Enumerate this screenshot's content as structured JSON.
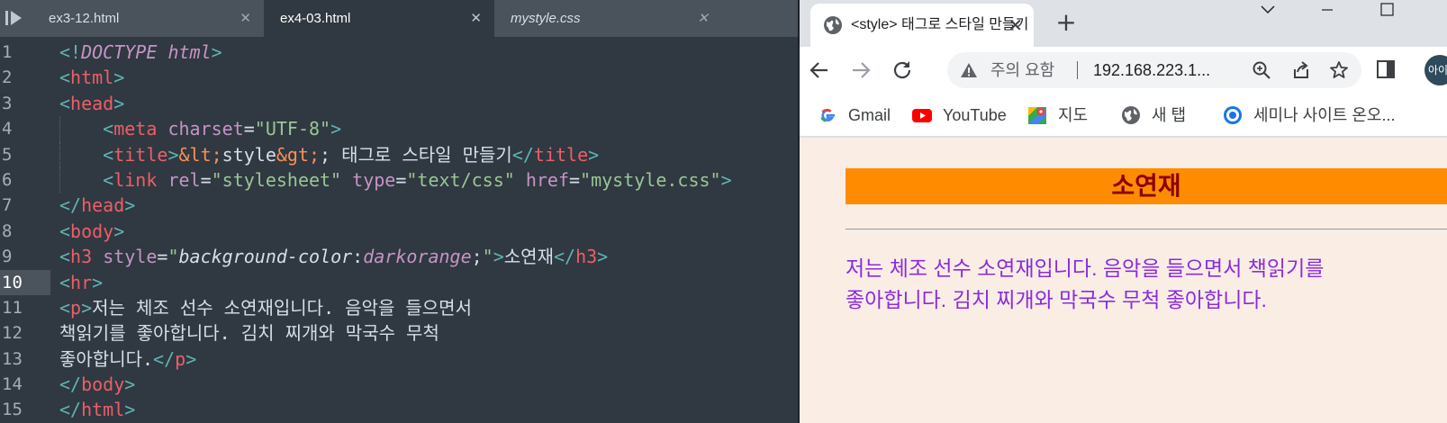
{
  "editor": {
    "tabs": [
      {
        "label": "ex3-12.html",
        "close": "✕"
      },
      {
        "label": "ex4-03.html",
        "close": "✕"
      },
      {
        "label": "mystyle.css",
        "close": "✕"
      }
    ],
    "current_line": 10,
    "lines": [
      {
        "num": "1",
        "tokens": [
          [
            "p",
            "<!"
          ],
          [
            "kw",
            "DOCTYPE"
          ],
          [
            "w",
            " "
          ],
          [
            "kw",
            "html"
          ],
          [
            "p",
            ">"
          ]
        ]
      },
      {
        "num": "2",
        "tokens": [
          [
            "p",
            "<"
          ],
          [
            "t",
            "html"
          ],
          [
            "p",
            ">"
          ]
        ]
      },
      {
        "num": "3",
        "tokens": [
          [
            "p",
            "<"
          ],
          [
            "t",
            "head"
          ],
          [
            "p",
            ">"
          ]
        ]
      },
      {
        "num": "4",
        "indent": "    ",
        "tokens": [
          [
            "p",
            "<"
          ],
          [
            "t",
            "meta"
          ],
          [
            "w",
            " "
          ],
          [
            "a",
            "charset"
          ],
          [
            "w",
            "="
          ],
          [
            "s",
            "\"UTF-8\""
          ],
          [
            "p",
            ">"
          ]
        ]
      },
      {
        "num": "5",
        "indent": "    ",
        "tokens": [
          [
            "p",
            "<"
          ],
          [
            "t",
            "title"
          ],
          [
            "p",
            ">"
          ],
          [
            "e",
            "&lt;"
          ],
          [
            "w",
            "style"
          ],
          [
            "e",
            "&gt;"
          ],
          [
            "w",
            "; 태그로 스타일 만들기"
          ],
          [
            "p",
            "</"
          ],
          [
            "t",
            "title"
          ],
          [
            "p",
            ">"
          ]
        ]
      },
      {
        "num": "6",
        "indent": "    ",
        "tokens": [
          [
            "p",
            "<"
          ],
          [
            "t",
            "link"
          ],
          [
            "w",
            " "
          ],
          [
            "a",
            "rel"
          ],
          [
            "w",
            "="
          ],
          [
            "s",
            "\"stylesheet\""
          ],
          [
            "w",
            " "
          ],
          [
            "a",
            "type"
          ],
          [
            "w",
            "="
          ],
          [
            "s",
            "\"text/css\""
          ],
          [
            "w",
            " "
          ],
          [
            "a",
            "href"
          ],
          [
            "w",
            "="
          ],
          [
            "s",
            "\"mystyle.css\""
          ],
          [
            "p",
            ">"
          ]
        ]
      },
      {
        "num": "7",
        "tokens": [
          [
            "p",
            "</"
          ],
          [
            "t",
            "head"
          ],
          [
            "p",
            ">"
          ]
        ]
      },
      {
        "num": "8",
        "tokens": [
          [
            "p",
            "<"
          ],
          [
            "t",
            "body"
          ],
          [
            "p",
            ">"
          ]
        ]
      },
      {
        "num": "9",
        "tokens": [
          [
            "p",
            "<"
          ],
          [
            "t",
            "h3"
          ],
          [
            "w",
            " "
          ],
          [
            "a",
            "style"
          ],
          [
            "w",
            "="
          ],
          [
            "s",
            "\""
          ],
          [
            "wi",
            "background-color"
          ],
          [
            "w",
            ":"
          ],
          [
            "ai",
            "darkorange"
          ],
          [
            "w",
            ";"
          ],
          [
            "s",
            "\""
          ],
          [
            "p",
            ">"
          ],
          [
            "w",
            "소연재"
          ],
          [
            "p",
            "</"
          ],
          [
            "t",
            "h3"
          ],
          [
            "p",
            ">"
          ]
        ]
      },
      {
        "num": "10",
        "tokens": [
          [
            "p",
            "<"
          ],
          [
            "t",
            "hr"
          ],
          [
            "p",
            ">"
          ]
        ]
      },
      {
        "num": "11",
        "tokens": [
          [
            "p",
            "<"
          ],
          [
            "t",
            "p"
          ],
          [
            "p",
            ">"
          ],
          [
            "w",
            "저는 체조 선수 소연재입니다. 음악을 들으면서"
          ]
        ]
      },
      {
        "num": "12",
        "tokens": [
          [
            "w",
            "책읽기를 좋아합니다. 김치 찌개와 막국수 무척"
          ]
        ]
      },
      {
        "num": "13",
        "tokens": [
          [
            "w",
            "좋아합니다."
          ],
          [
            "p",
            "</"
          ],
          [
            "t",
            "p"
          ],
          [
            "p",
            ">"
          ]
        ]
      },
      {
        "num": "14",
        "tokens": [
          [
            "p",
            "</"
          ],
          [
            "t",
            "body"
          ],
          [
            "p",
            ">"
          ]
        ]
      },
      {
        "num": "15",
        "tokens": [
          [
            "p",
            "</"
          ],
          [
            "t",
            "html"
          ],
          [
            "p",
            ">"
          ]
        ]
      }
    ]
  },
  "browser": {
    "tab_title": "<style> 태그로 스타일 만들기",
    "tab_close": "✕",
    "new_tab": "+",
    "security_warning": "주의 요함",
    "url": "192.168.223.1...",
    "avatar_text": "아이",
    "bookmarks": [
      {
        "label": "Gmail",
        "icon": "google-icon"
      },
      {
        "label": "YouTube",
        "icon": "youtube-icon"
      },
      {
        "label": "지도",
        "icon": "maps-icon"
      },
      {
        "label": "새 탭",
        "icon": "globe-icon"
      },
      {
        "label": "세미나 사이트 온오...",
        "icon": "chromium-icon"
      }
    ],
    "page": {
      "heading": "소연재",
      "paragraph_line1": "저는 체조 선수 소연재입니다. 음악을 들으면서 책읽기를",
      "paragraph_line2": "좋아합니다. 김치 찌개와 막국수 무척 좋아합니다."
    }
  },
  "colors": {
    "editor_bg": "#303841",
    "tag": "#ec5f67",
    "attribute": "#c594c5",
    "string": "#99c794",
    "punct": "#5fb4b4",
    "heading_bg": "darkorange",
    "heading_text": "#8b0000",
    "paragraph_text": "#8a2be2",
    "page_bg": "#faeee4"
  }
}
